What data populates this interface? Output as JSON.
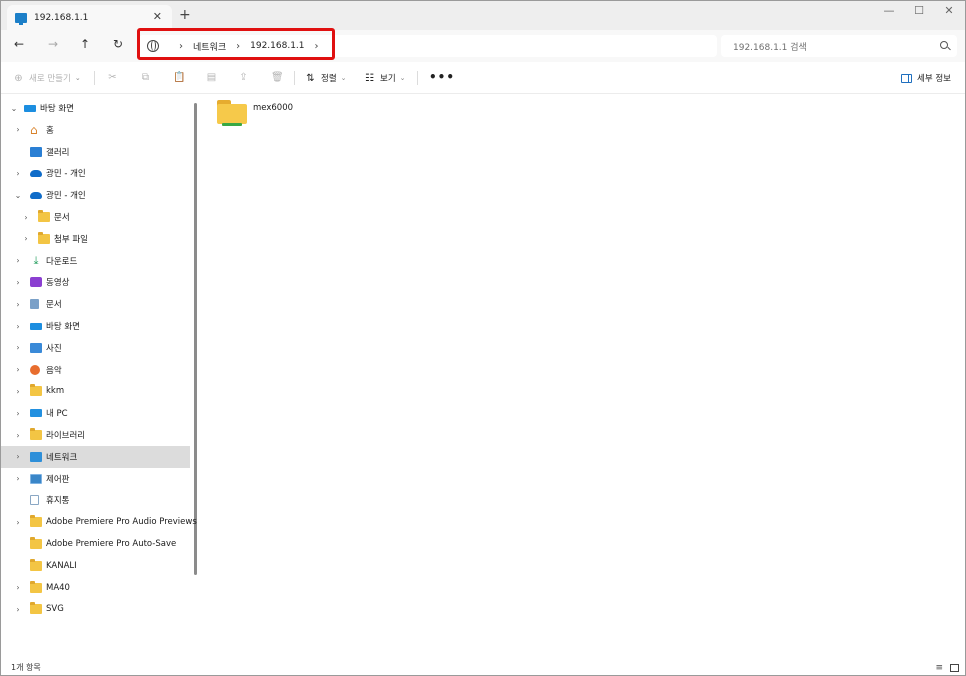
{
  "window": {
    "tab_title": "192.168.1.1",
    "tab_close": "✕",
    "new_tab": "+",
    "minimize": "—",
    "maximize": "☐",
    "close": "✕"
  },
  "nav": {
    "back": "←",
    "forward": "→",
    "up": "↑",
    "refresh": "↻",
    "breadcrumbs": [
      "네트워크",
      "192.168.1.1"
    ],
    "separator": "›",
    "search_placeholder": "192.168.1.1 검색"
  },
  "command_bar": {
    "new_label": "새로 만들기",
    "sort_label": "정렬",
    "view_label": "보기",
    "more_label": "•••",
    "details_label": "세부 정보",
    "chevron": "⌄"
  },
  "sidebar": {
    "items": [
      {
        "label": "바탕 화면",
        "icon": "desktop-icon",
        "twisty": "⌄"
      },
      {
        "label": "홈",
        "icon": "home-icon",
        "twisty": "›"
      },
      {
        "label": "갤러리",
        "icon": "gallery-icon",
        "twisty": ""
      },
      {
        "label": "광민 - 개인",
        "icon": "onedrive-icon",
        "twisty": "›"
      },
      {
        "label": "광민 - 개인",
        "icon": "onedrive-icon",
        "twisty": "⌄"
      },
      {
        "label": "문서",
        "icon": "folder-icon",
        "twisty": "›"
      },
      {
        "label": "첨부 파일",
        "icon": "folder-icon",
        "twisty": "›"
      },
      {
        "label": "다운로드",
        "icon": "download-icon",
        "twisty": "›"
      },
      {
        "label": "동영상",
        "icon": "video-icon",
        "twisty": "›"
      },
      {
        "label": "문서",
        "icon": "document-icon",
        "twisty": "›"
      },
      {
        "label": "바탕 화면",
        "icon": "desktop-icon",
        "twisty": "›"
      },
      {
        "label": "사진",
        "icon": "picture-icon",
        "twisty": "›"
      },
      {
        "label": "음악",
        "icon": "music-icon",
        "twisty": "›"
      },
      {
        "label": "kkm",
        "icon": "folder-icon",
        "twisty": "›"
      },
      {
        "label": "내 PC",
        "icon": "pc-icon",
        "twisty": "›"
      },
      {
        "label": "라이브러리",
        "icon": "folder-icon",
        "twisty": "›"
      },
      {
        "label": "네트워크",
        "icon": "network-icon",
        "twisty": "›"
      },
      {
        "label": "제어판",
        "icon": "control-panel-icon",
        "twisty": "›"
      },
      {
        "label": "휴지통",
        "icon": "recycle-bin-icon",
        "twisty": ""
      },
      {
        "label": "Adobe Premiere Pro Audio Previews",
        "icon": "folder-icon",
        "twisty": "›"
      },
      {
        "label": "Adobe Premiere Pro Auto-Save",
        "icon": "folder-icon",
        "twisty": ""
      },
      {
        "label": "KANALI",
        "icon": "folder-icon",
        "twisty": ""
      },
      {
        "label": "MA40",
        "icon": "folder-icon",
        "twisty": "›"
      },
      {
        "label": "SVG",
        "icon": "folder-icon",
        "twisty": "›"
      }
    ],
    "selected_label": "네트워크"
  },
  "content": {
    "items": [
      {
        "name": "mex6000",
        "icon": "shared-folder-icon"
      }
    ]
  },
  "status": {
    "item_count": "1개 항목",
    "list_view": "≡"
  },
  "colors": {
    "highlight_box": "#e01010",
    "selection": "#dcdcdc",
    "folder": "#f6c94a"
  }
}
